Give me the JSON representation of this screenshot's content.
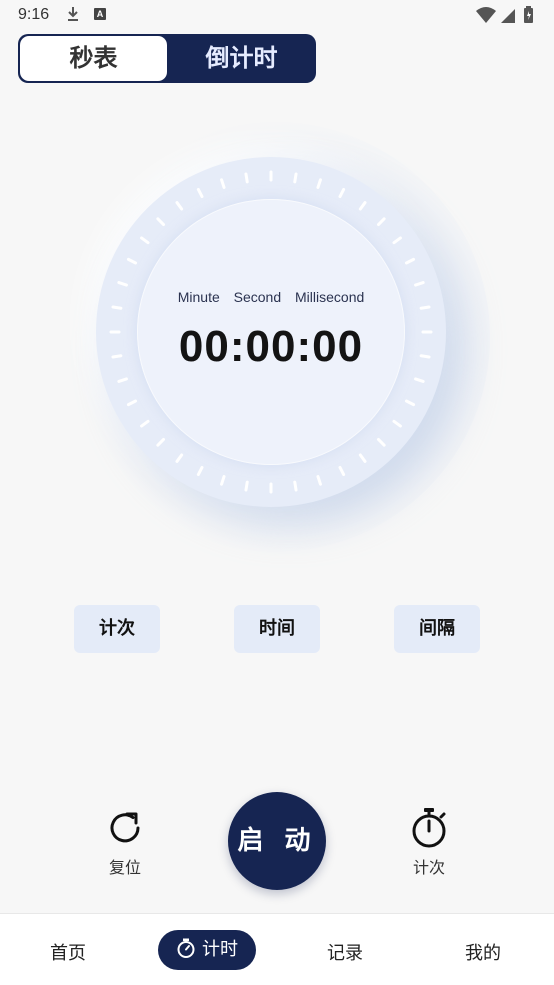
{
  "status_bar": {
    "time": "9:16",
    "icons": [
      "download-icon",
      "a-app-icon",
      "wifi-icon",
      "signal-icon",
      "battery-icon"
    ]
  },
  "mode_toggle": {
    "stopwatch_label": "秒表",
    "countdown_label": "倒计时",
    "selected": "stopwatch_label"
  },
  "dial": {
    "labels": [
      "Minute",
      "Second",
      "Millisecond"
    ],
    "time": "00:00:00"
  },
  "chips": {
    "count": "计次",
    "time": "时间",
    "interval": "间隔"
  },
  "controls": {
    "reset_label": "复位",
    "start_label": "启 动",
    "lap_label": "计次"
  },
  "bottom_nav": {
    "items": [
      {
        "label": "首页"
      },
      {
        "label": "计时",
        "active": true
      },
      {
        "label": "记录"
      },
      {
        "label": "我的"
      }
    ]
  },
  "colors": {
    "accent": "#162552",
    "dial_outer": "#e6ecf8",
    "dial_inner": "#eef2fb",
    "chip_bg": "#e4ebf8",
    "background": "#f7f7f7"
  }
}
